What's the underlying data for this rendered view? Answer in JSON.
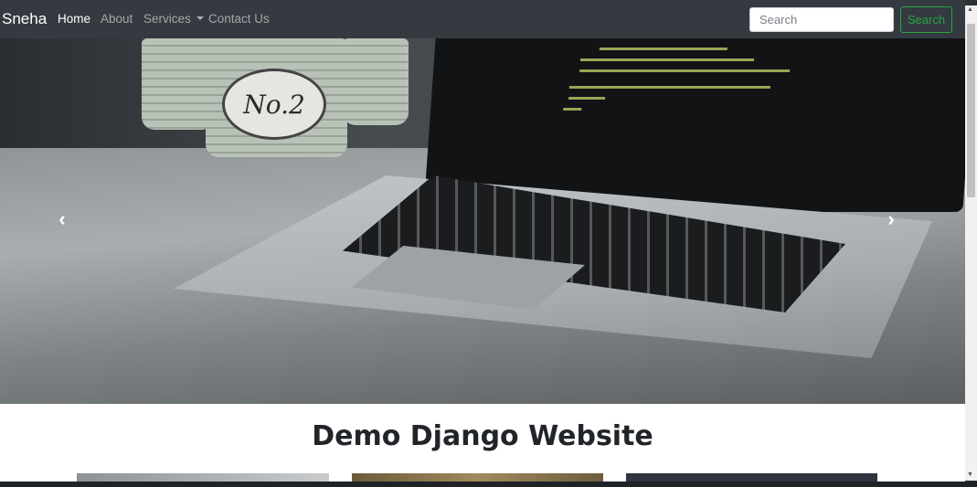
{
  "navbar": {
    "brand": "Sneha",
    "links": [
      {
        "label": "Home",
        "active": true
      },
      {
        "label": "About",
        "active": false
      },
      {
        "label": "Services",
        "active": false,
        "dropdown": true
      },
      {
        "label": "Contact Us",
        "active": false
      }
    ],
    "search": {
      "placeholder": "Search",
      "button_label": "Search"
    }
  },
  "carousel": {
    "image_label_text": "No.2",
    "prev_icon": "chevron-left-icon",
    "next_icon": "chevron-right-icon",
    "prev_glyph": "‹",
    "next_glyph": "›"
  },
  "main": {
    "heading": "Demo Django Website"
  },
  "colors": {
    "navbar_bg": "#343a40",
    "search_button": "#28a745",
    "heading_text": "#212529"
  }
}
